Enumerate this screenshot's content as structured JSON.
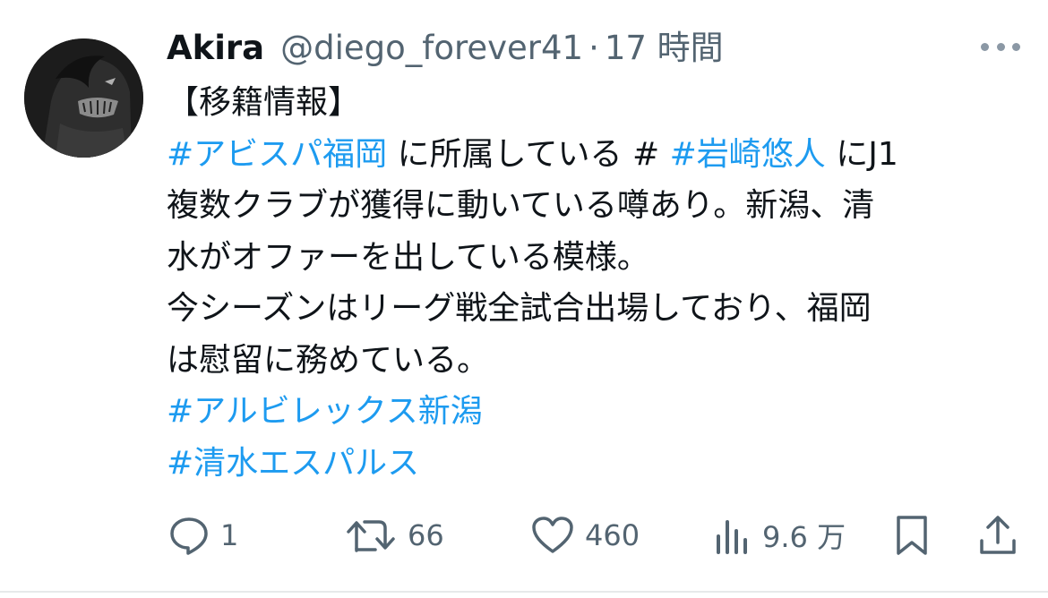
{
  "tweet": {
    "display_name": "Akira",
    "handle": "@diego_forever41",
    "separator": "·",
    "time": "17 時間",
    "lines": [
      [
        {
          "t": "【移籍情報】",
          "tag": false
        }
      ],
      [
        {
          "t": " #アビスパ福岡",
          "tag": true
        },
        {
          "t": " に所属している # ",
          "tag": false
        },
        {
          "t": "#岩崎悠人",
          "tag": true
        },
        {
          "t": " にJ1",
          "tag": false
        }
      ],
      [
        {
          "t": "複数クラブが獲得に動いている噂あり。新潟、清",
          "tag": false
        }
      ],
      [
        {
          "t": "水がオファーを出している模様。",
          "tag": false
        }
      ],
      [
        {
          "t": "今シーズンはリーグ戦全試合出場しており、福岡",
          "tag": false
        }
      ],
      [
        {
          "t": "は慰留に務めている。",
          "tag": false
        }
      ],
      [
        {
          "t": " #アルビレックス新潟",
          "tag": true
        }
      ],
      [
        {
          "t": " #清水エスパルス",
          "tag": true
        }
      ]
    ]
  },
  "actions": {
    "reply": {
      "icon": "reply-icon",
      "count": "1"
    },
    "retweet": {
      "icon": "retweet-icon",
      "count": "66"
    },
    "like": {
      "icon": "heart-icon",
      "count": "460"
    },
    "views": {
      "icon": "views-chart-icon",
      "count": "9.6 万"
    },
    "bookmark": {
      "icon": "bookmark-icon"
    },
    "share": {
      "icon": "share-icon"
    }
  },
  "colors": {
    "text": "#0f1419",
    "secondary": "#536471",
    "hashtag": "#1d9bf0"
  }
}
